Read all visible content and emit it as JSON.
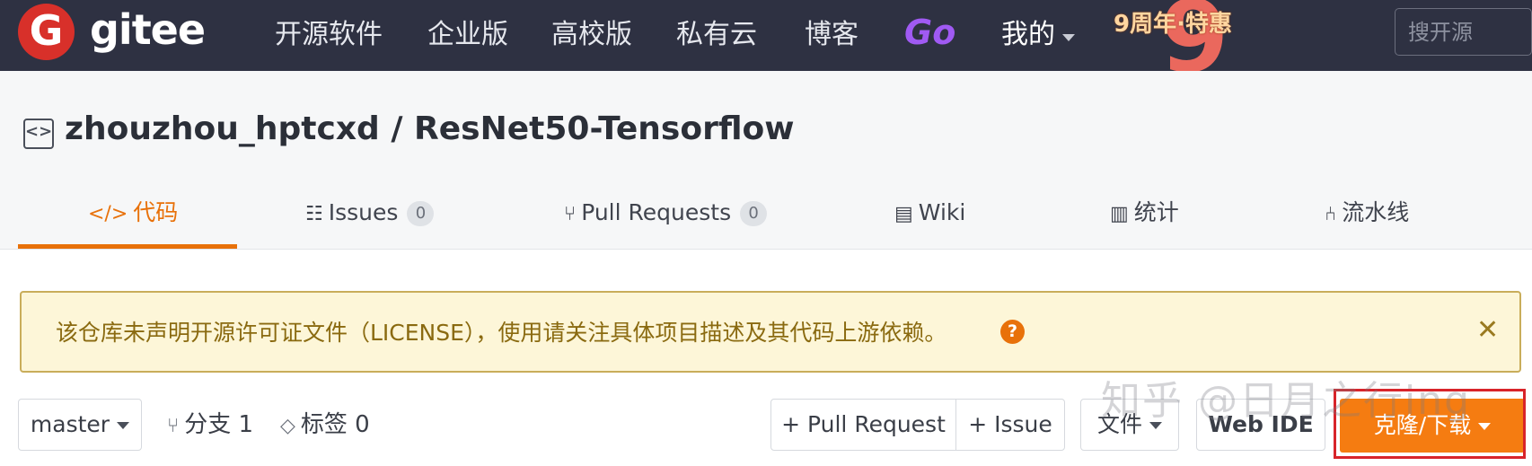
{
  "brand": {
    "logo_letter": "G",
    "name": "gitee"
  },
  "nav": {
    "items": [
      "开源软件",
      "企业版",
      "高校版",
      "私有云",
      "博客"
    ],
    "go_label": "Go",
    "mine_label": "我的",
    "promo_text": "9周年·特惠",
    "promo_number": "9"
  },
  "search": {
    "placeholder": "搜开源"
  },
  "repo": {
    "title": "zhouzhou_hptcxd / ResNet50-Tensorflow",
    "icon_glyph": "<>"
  },
  "tabs": {
    "code": {
      "icon": "</>",
      "label": "代码"
    },
    "issues": {
      "label": "Issues",
      "count": "0"
    },
    "pull_requests": {
      "label": "Pull Requests",
      "count": "0"
    },
    "wiki": {
      "label": "Wiki"
    },
    "stats": {
      "label": "统计"
    },
    "pipeline": {
      "label": "流水线"
    }
  },
  "notice": {
    "text": "该仓库未声明开源许可证文件（LICENSE），使用请关注具体项目描述及其代码上游依赖。",
    "help_glyph": "?",
    "close_glyph": "✕"
  },
  "toolbar": {
    "branch": "master",
    "branches_label": "分支 1",
    "tags_label": "标签 0",
    "pull_request_btn": "+ Pull Request",
    "issue_btn": "+ Issue",
    "file_btn": "文件",
    "webide_btn": "Web IDE",
    "clone_btn": "克隆/下载"
  },
  "watermark": "知乎 @日月之行ing",
  "colors": {
    "navbar_bg": "#2e3142",
    "accent_orange": "#e8710a",
    "clone_button": "#f57c11",
    "notice_bg": "#fdf6d8",
    "highlight_red": "#d8242a"
  }
}
